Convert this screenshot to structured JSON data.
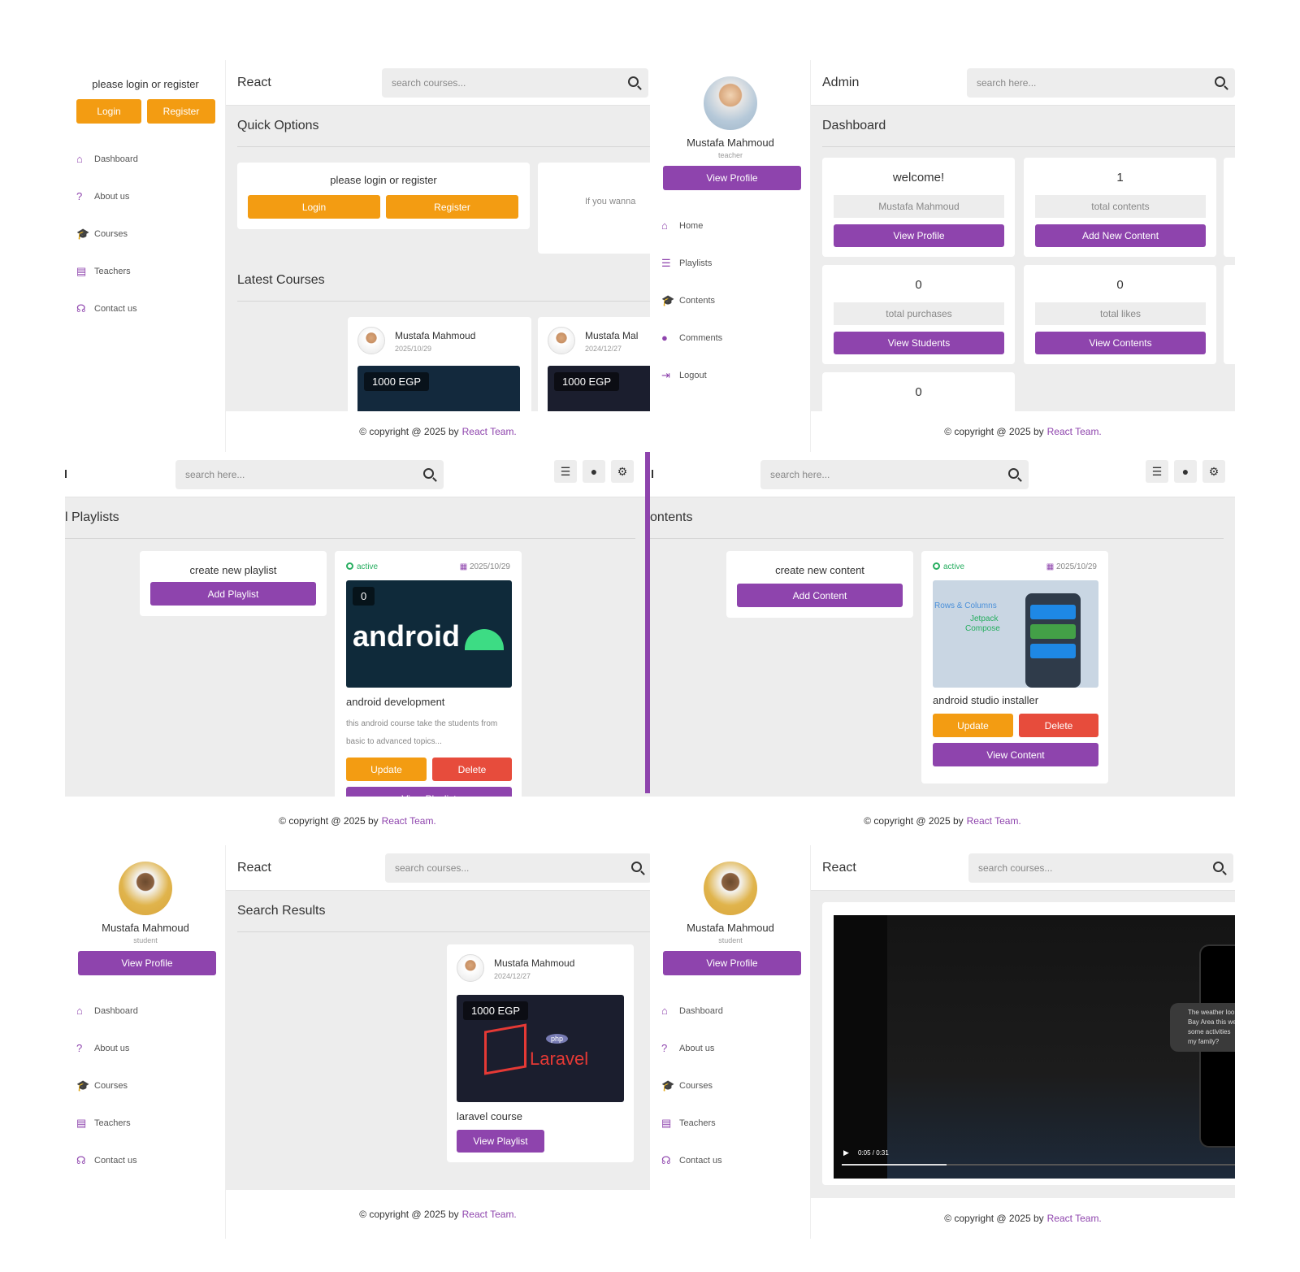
{
  "panel1": {
    "sidebar": {
      "prompt": "please login or register",
      "login": "Login",
      "register": "Register",
      "nav": [
        {
          "icon": "home-icon",
          "glyph": "⌂",
          "label": "Dashboard"
        },
        {
          "icon": "question-icon",
          "glyph": "?",
          "label": "About us"
        },
        {
          "icon": "graduation-cap-icon",
          "glyph": "🎓",
          "label": "Courses"
        },
        {
          "icon": "chalkboard-teacher-icon",
          "glyph": "▤",
          "label": "Teachers"
        },
        {
          "icon": "headset-icon",
          "glyph": "☊",
          "label": "Contact us"
        }
      ]
    },
    "logo": "React",
    "search_placeholder": "search courses...",
    "quick_title": "Quick Options",
    "quick_prompt": "please login or register",
    "quick_login": "Login",
    "quick_register": "Register",
    "quick_side_text": "If you wanna",
    "latest_title": "Latest Courses",
    "courses": [
      {
        "teacher": "Mustafa Mahmoud",
        "date": "2025/10/29",
        "price": "1000 EGP"
      },
      {
        "teacher": "Mustafa Mal",
        "date": "2024/12/27",
        "price": "1000 EGP"
      }
    ],
    "footer_prefix": "© copyright @ 2025 by",
    "footer_team": "React Team."
  },
  "panel2": {
    "profile": {
      "name": "Mustafa Mahmoud",
      "role": "teacher",
      "view_profile": "View Profile"
    },
    "nav": [
      {
        "icon": "home-icon",
        "glyph": "⌂",
        "label": "Home"
      },
      {
        "icon": "bars-icon",
        "glyph": "☰",
        "label": "Playlists"
      },
      {
        "icon": "graduation-cap-icon",
        "glyph": "🎓",
        "label": "Contents"
      },
      {
        "icon": "comment-icon",
        "glyph": "●",
        "label": "Comments"
      },
      {
        "icon": "logout-icon",
        "glyph": "⇥",
        "label": "Logout"
      }
    ],
    "logo": "Admin",
    "search_placeholder": "search here...",
    "title": "Dashboard",
    "welcome": "welcome!",
    "welcome_name": "Mustafa Mahmoud",
    "welcome_btn": "View Profile",
    "contents_count": "1",
    "contents_label": "total contents",
    "contents_btn": "Add New Content",
    "purchases_count": "0",
    "purchases_label": "total purchases",
    "purchases_btn": "View Students",
    "likes_count": "0",
    "likes_label": "total likes",
    "likes_btn": "View Contents",
    "extra_count": "0",
    "footer_prefix": "© copyright @ 2025 by",
    "footer_team": "React Team."
  },
  "panel3": {
    "search_placeholder": "search here...",
    "title": "l Playlists",
    "create_label": "create new playlist",
    "create_btn": "Add Playlist",
    "playlist": {
      "status": "active",
      "date": "2025/10/29",
      "count": "0",
      "thumb_text": "android",
      "name": "android development",
      "desc": "this android course take the students from basic to advanced topics...",
      "update": "Update",
      "delete": "Delete",
      "view": "View Playlist"
    },
    "footer_prefix": "© copyright @ 2025 by",
    "footer_team": "React Team."
  },
  "panel4": {
    "search_placeholder": "search here...",
    "title": "ontents",
    "create_label": "create new content",
    "create_btn": "Add Content",
    "content": {
      "status": "active",
      "date": "2025/10/29",
      "thumb_line1": "Rows & Columns",
      "thumb_line2": "Jetpack",
      "thumb_line3": "Compose",
      "name": "android studio installer",
      "update": "Update",
      "delete": "Delete",
      "view": "View Content"
    },
    "footer_prefix": "© copyright @ 2025 by",
    "footer_team": "React Team."
  },
  "panel5": {
    "profile": {
      "name": "Mustafa Mahmoud",
      "role": "student",
      "view_profile": "View Profile"
    },
    "nav": [
      {
        "icon": "home-icon",
        "glyph": "⌂",
        "label": "Dashboard"
      },
      {
        "icon": "question-icon",
        "glyph": "?",
        "label": "About us"
      },
      {
        "icon": "graduation-cap-icon",
        "glyph": "🎓",
        "label": "Courses"
      },
      {
        "icon": "chalkboard-teacher-icon",
        "glyph": "▤",
        "label": "Teachers"
      },
      {
        "icon": "headset-icon",
        "glyph": "☊",
        "label": "Contact us"
      }
    ],
    "logo": "React",
    "search_placeholder": "search courses...",
    "title": "Search Results",
    "course": {
      "teacher": "Mustafa Mahmoud",
      "date": "2024/12/27",
      "price": "1000 EGP",
      "php": "php",
      "thumb_text": "Laravel",
      "name": "laravel course",
      "view": "View Playlist"
    },
    "footer_prefix": "© copyright @ 2025 by",
    "footer_team": "React Team."
  },
  "panel6": {
    "profile": {
      "name": "Mustafa Mahmoud",
      "role": "student",
      "view_profile": "View Profile"
    },
    "nav": [
      {
        "icon": "home-icon",
        "glyph": "⌂",
        "label": "Dashboard"
      },
      {
        "icon": "question-icon",
        "glyph": "?",
        "label": "About us"
      },
      {
        "icon": "graduation-cap-icon",
        "glyph": "🎓",
        "label": "Courses"
      },
      {
        "icon": "chalkboard-teacher-icon",
        "glyph": "▤",
        "label": "Teachers"
      },
      {
        "icon": "headset-icon",
        "glyph": "☊",
        "label": "Contact us"
      }
    ],
    "logo": "React",
    "search_placeholder": "search courses...",
    "video": {
      "time": "0:05 / 0:31",
      "progress": 0.26,
      "bubble": "The weather loo Bay Area this we some activities my family?"
    },
    "footer_prefix": "© copyright @ 2025 by",
    "footer_team": "React Team."
  },
  "colors": {
    "accent": "#8e44ad",
    "orange": "#f39c12",
    "red": "#e74c3c",
    "green": "#27ae60"
  }
}
